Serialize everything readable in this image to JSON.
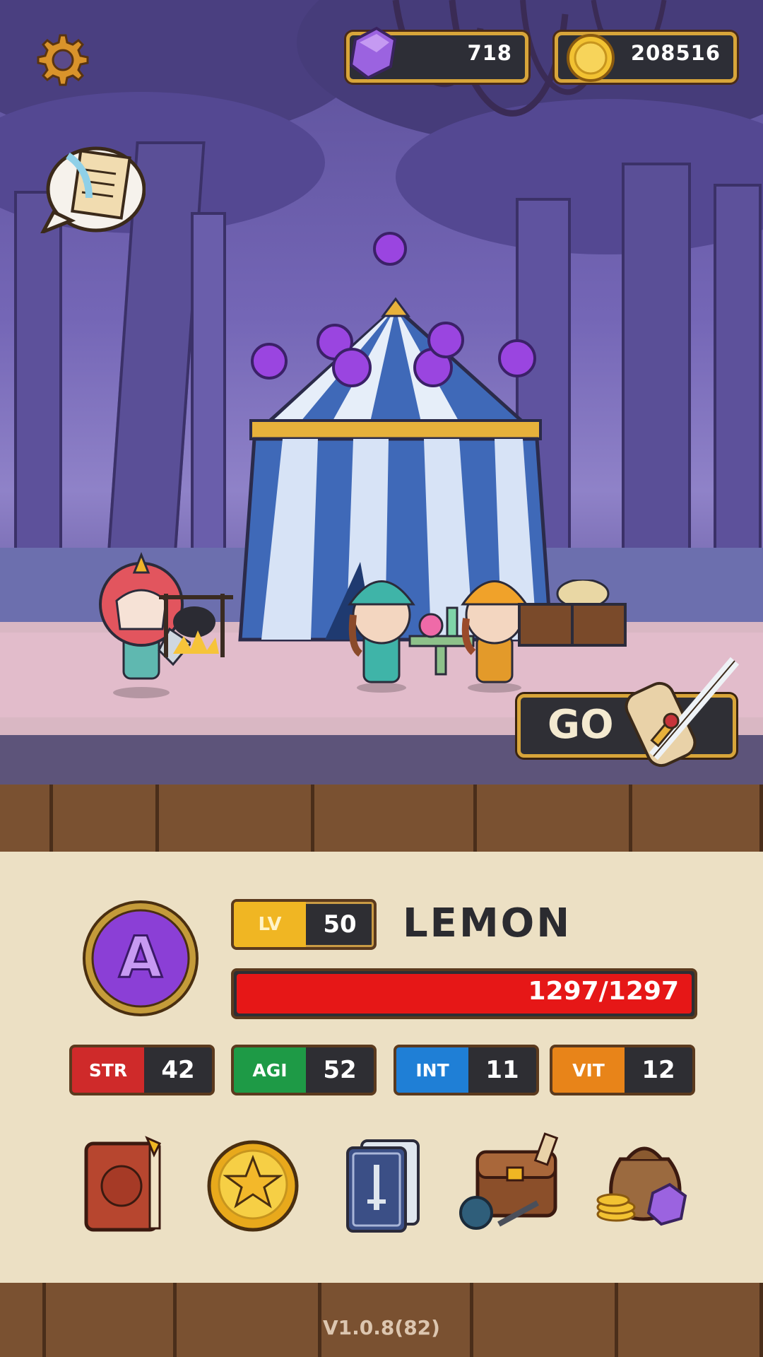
{
  "hud": {
    "gems": "718",
    "coins": "208516"
  },
  "scene": {
    "go_label": "GO"
  },
  "hero": {
    "level_key": "LV",
    "level": "50",
    "name": "LEMON",
    "hp": "1297/1297",
    "hp_fraction": 1.0
  },
  "stats": [
    {
      "key": "STR",
      "value": "42",
      "color": "#cf2a2a"
    },
    {
      "key": "AGI",
      "value": "52",
      "color": "#1e9a46"
    },
    {
      "key": "INT",
      "value": "11",
      "color": "#1f7fd6"
    },
    {
      "key": "VIT",
      "value": "12",
      "color": "#e88419"
    }
  ],
  "menu": [
    {
      "name": "hero-book-icon"
    },
    {
      "name": "star-coin-icon"
    },
    {
      "name": "skill-cards-icon"
    },
    {
      "name": "inventory-bag-icon"
    },
    {
      "name": "treasure-sack-icon"
    }
  ],
  "footer": {
    "version": "V1.0.8(82)"
  },
  "colors": {
    "hp_bar": "#e61717",
    "frame_gold": "#d8a53a",
    "lv_gold": "#f0b623"
  }
}
